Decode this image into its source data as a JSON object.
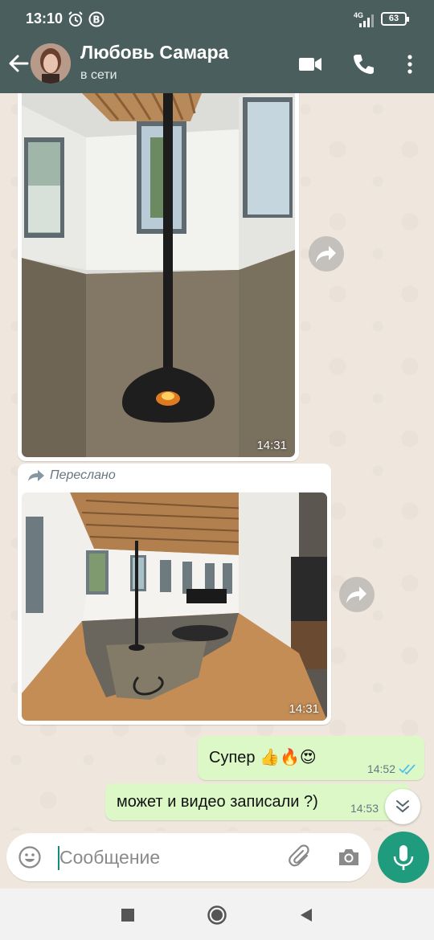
{
  "status_bar": {
    "time": "13:10",
    "network": "4G",
    "battery": "63"
  },
  "header": {
    "contact_name": "Любовь Самара",
    "presence": "в сети"
  },
  "messages": {
    "image1": {
      "time": "14:31"
    },
    "image2": {
      "forwarded_label": "Переслано",
      "time": "14:31"
    },
    "out1": {
      "text": "Супер 👍🔥😍",
      "time": "14:52"
    },
    "out2": {
      "text": "может и видео записали ?)",
      "time": "14:53"
    }
  },
  "composer": {
    "placeholder": "Сообщение"
  },
  "colors": {
    "header": "#4a5f5d",
    "outgoing_bubble": "#dcf8c6",
    "accent": "#1f9b7d",
    "read_ticks": "#53bdeb"
  },
  "icons": [
    "alarm-icon",
    "b-icon",
    "signal-icon",
    "battery-icon",
    "back-arrow-icon",
    "video-call-icon",
    "phone-icon",
    "more-icon",
    "forward-icon",
    "double-check-icon",
    "chevron-down-icon",
    "emoji-icon",
    "attach-icon",
    "camera-icon",
    "mic-icon",
    "square-nav-icon",
    "circle-nav-icon",
    "triangle-nav-icon"
  ]
}
